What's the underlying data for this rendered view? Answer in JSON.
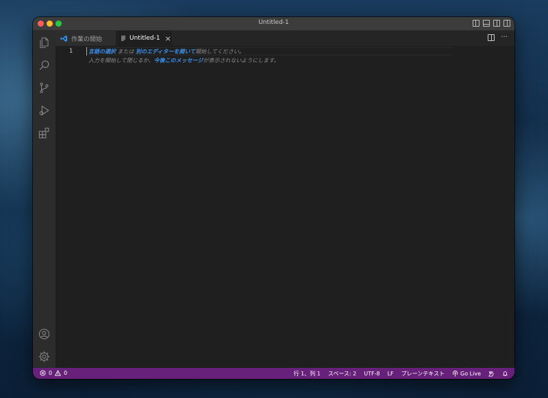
{
  "window": {
    "title": "Untitled-1"
  },
  "tabs": [
    {
      "label": "作業の開始",
      "icon": "vscode-logo-icon",
      "active": false
    },
    {
      "label": "Untitled-1",
      "icon": "file-text-icon",
      "active": true,
      "close": "×"
    }
  ],
  "editor": {
    "line_number": "1",
    "hint_line1": {
      "link1": "言語の選択",
      "text1": "または",
      "link2": "別のエディターを開いて",
      "text2": "開始してください。"
    },
    "hint_line2": {
      "text1": "入力を開始して閉じるか、",
      "link1": "今後このメッセージ",
      "text2": "が表示されないようにします。"
    }
  },
  "activitybar": [
    "explorer-icon",
    "search-icon",
    "source-control-icon",
    "run-debug-icon",
    "extensions-icon",
    "account-icon",
    "settings-gear-icon"
  ],
  "statusbar": {
    "errors": "0",
    "warnings": "0",
    "position": "行 1、列 1",
    "spaces": "スペース: 2",
    "encoding": "UTF-8",
    "eol": "LF",
    "language": "プレーンテキスト",
    "golive": "Go Live"
  },
  "colors": {
    "statusbar": "#68217a",
    "link": "#3d8ee6",
    "editor_bg": "#1f1f1f"
  }
}
